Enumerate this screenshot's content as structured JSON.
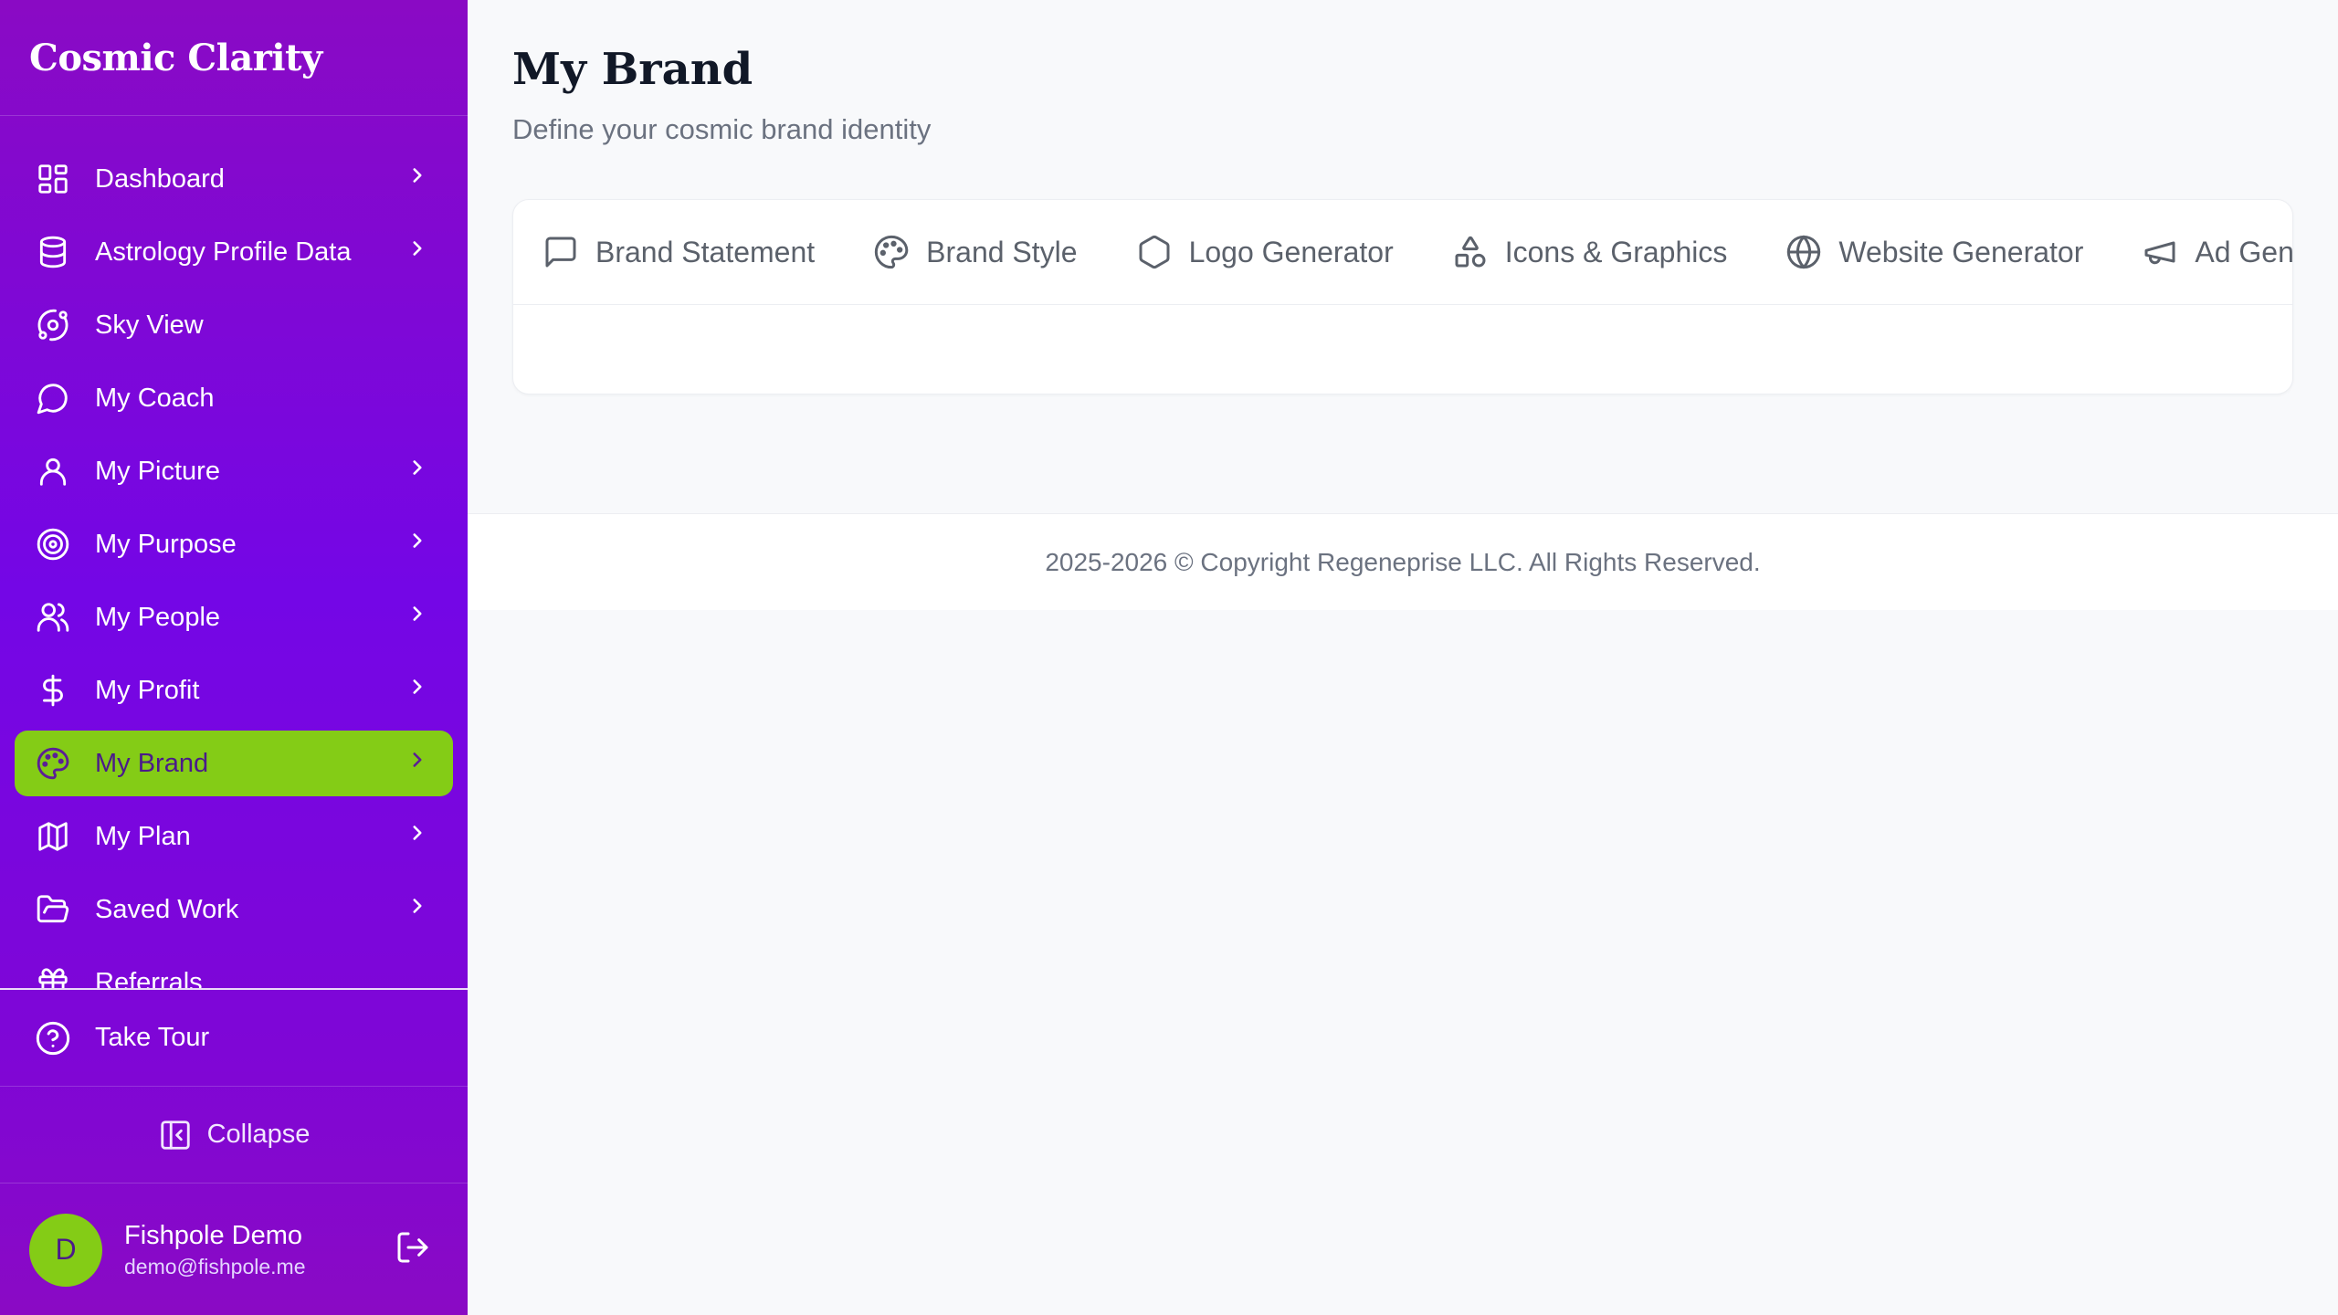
{
  "app": {
    "title": "Cosmic Clarity"
  },
  "sidebar": {
    "items": [
      {
        "label": "Dashboard",
        "icon": "dashboard-icon",
        "has_children": true
      },
      {
        "label": "Astrology Profile Data",
        "icon": "database-icon",
        "has_children": true
      },
      {
        "label": "Sky View",
        "icon": "orbit-icon",
        "has_children": false
      },
      {
        "label": "My Coach",
        "icon": "chat-icon",
        "has_children": false
      },
      {
        "label": "My Picture",
        "icon": "user-icon",
        "has_children": true
      },
      {
        "label": "My Purpose",
        "icon": "target-icon",
        "has_children": true
      },
      {
        "label": "My People",
        "icon": "users-icon",
        "has_children": true
      },
      {
        "label": "My Profit",
        "icon": "dollar-icon",
        "has_children": true
      },
      {
        "label": "My Brand",
        "icon": "palette-icon",
        "has_children": true,
        "active": true
      },
      {
        "label": "My Plan",
        "icon": "map-icon",
        "has_children": true
      },
      {
        "label": "Saved Work",
        "icon": "folder-icon",
        "has_children": true
      },
      {
        "label": "Referrals",
        "icon": "gift-icon",
        "has_children": false
      }
    ],
    "take_tour": "Take Tour",
    "collapse": "Collapse",
    "user": {
      "initial": "D",
      "name": "Fishpole Demo",
      "email": "demo@fishpole.me"
    }
  },
  "main": {
    "title": "My Brand",
    "subtitle": "Define your cosmic brand identity",
    "tabs": [
      {
        "label": "Brand Statement",
        "icon": "message-square-icon"
      },
      {
        "label": "Brand Style",
        "icon": "palette-icon"
      },
      {
        "label": "Logo Generator",
        "icon": "hexagon-icon"
      },
      {
        "label": "Icons & Graphics",
        "icon": "shapes-icon"
      },
      {
        "label": "Website Generator",
        "icon": "globe-icon"
      },
      {
        "label": "Ad Generator",
        "icon": "megaphone-icon"
      }
    ]
  },
  "footer": {
    "text": "2025-2026 © Copyright Regeneprise LLC. All Rights Reserved."
  },
  "colors": {
    "sidebar_top": "#8a0ac4",
    "sidebar_mid": "#7406e6",
    "accent": "#84cc16",
    "active_text": "#4b1a8a"
  }
}
